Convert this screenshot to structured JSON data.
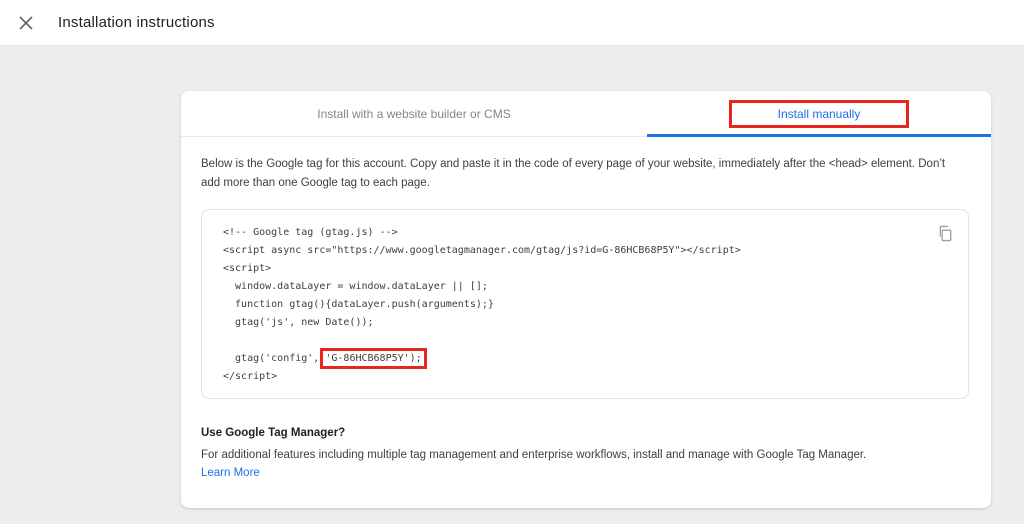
{
  "header": {
    "title": "Installation instructions"
  },
  "tabs": [
    {
      "label": "Install with a website builder or CMS",
      "active": false
    },
    {
      "label": "Install manually",
      "active": true
    }
  ],
  "intro_text": "Below is the Google tag for this account. Copy and paste it in the code of every page of your website, immediately after the <head> element. Don’t add more than one Google tag to each page.",
  "code": {
    "lines": [
      "<!-- Google tag (gtag.js) -->",
      "<script async src=\"https://www.googletagmanager.com/gtag/js?id=G-86HCB68P5Y\"></script>",
      "<script>",
      "  window.dataLayer = window.dataLayer || [];",
      "  function gtag(){dataLayer.push(arguments);}",
      "  gtag('js', new Date());",
      "",
      "  gtag('config', 'G-86HCB68P5Y');",
      "</script>"
    ],
    "highlight_line": 7,
    "highlight_text": "'G-86HCB68P5Y');",
    "measurement_id": "G-86HCB68P5Y",
    "copy_icon": "copy"
  },
  "gtm": {
    "heading": "Use Google Tag Manager?",
    "body": "For additional features including multiple tag management and enterprise workflows, install and manage with Google Tag Manager.",
    "link_label": "Learn More"
  },
  "icons": {
    "close": "close-icon",
    "copy": "copy-icon"
  },
  "colors": {
    "accent_blue": "#1a73e8",
    "annotation_red": "#e8261e",
    "inactive_tab_gray": "#80868b",
    "body_background": "#ecedef"
  }
}
